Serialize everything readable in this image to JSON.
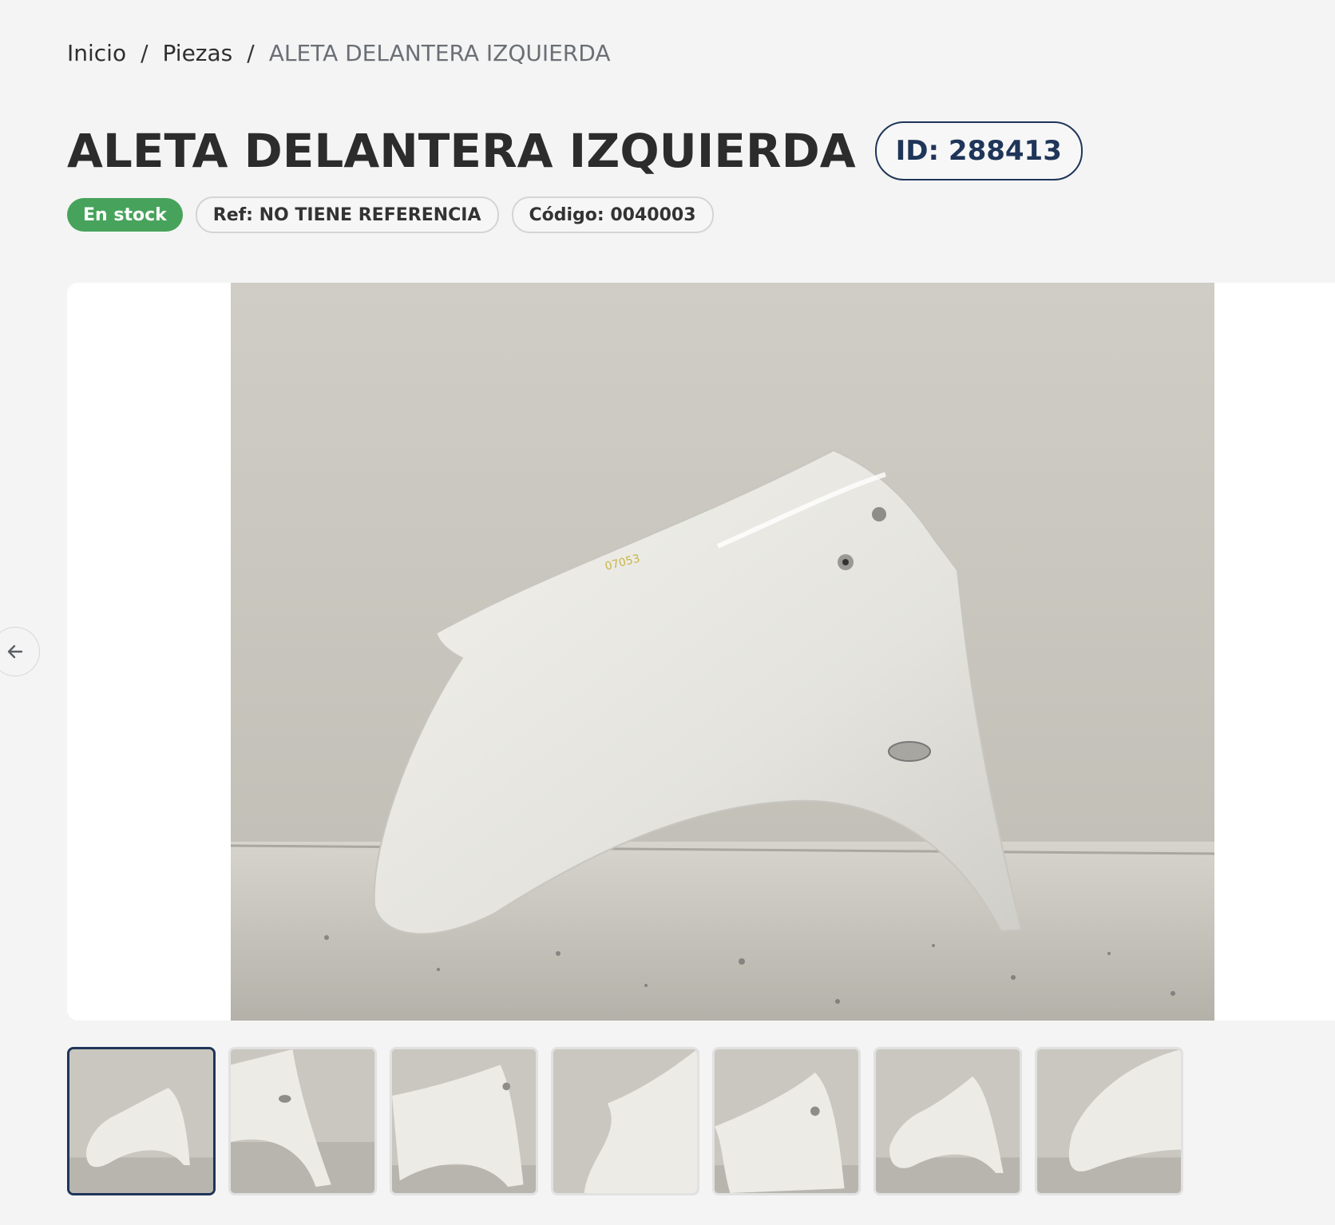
{
  "breadcrumb": {
    "items": [
      "Inicio",
      "Piezas"
    ],
    "current": "ALETA DELANTERA IZQUIERDA",
    "separator": "/"
  },
  "product": {
    "title": "ALETA DELANTERA IZQUIERDA",
    "id_label": "ID: 288413",
    "stock_label": "En stock",
    "ref_label": "Ref: NO TIENE REFERENCIA",
    "code_label": "Código: 0040003"
  },
  "gallery": {
    "prev_icon": "arrow-left-icon",
    "thumbnail_count": 7,
    "active_index": 0
  },
  "colors": {
    "accent": "#1f3559",
    "stock_green": "#47a35b",
    "background": "#f4f4f4"
  }
}
